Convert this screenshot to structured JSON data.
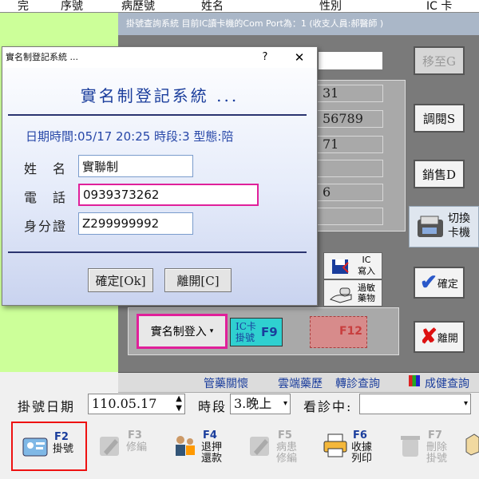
{
  "table_header": {
    "col1": "完",
    "col2": "序號",
    "col3": "病歷號",
    "col4": "姓名",
    "col5": "性別",
    "col6": "IC 卡"
  },
  "back_window": {
    "title": "掛號查詢系統 目前IC讀卡機的Com Port為：1 (收支人員:郝醫師 )",
    "field_values": [
      "31",
      "56789",
      "71",
      "",
      "6",
      ""
    ],
    "buttons": {
      "btn_top": "移至G",
      "btn_browse": "調閱S",
      "btn_cancel": "銷售D",
      "btn_switch": "切換\n卡機",
      "btn_confirm": "確定",
      "btn_leave": "離開"
    },
    "ic_write": {
      "title": "IC",
      "sub": "寫入"
    },
    "allergy": "過敏\n藥物",
    "realname_login": "實名制登入",
    "ic_register": {
      "line1": "IC卡",
      "line2": "掛號",
      "key": "F9"
    },
    "f12_label": "F12",
    "tabs": [
      "管藥關懷",
      "雲端藥歷",
      "轉診查詢",
      "成健查詢"
    ]
  },
  "dialog": {
    "titlebar": "實名制登記系統 ...",
    "help": "?",
    "close": "✕",
    "heading": "實名制登記系統 ...",
    "info": "日期時間:05/17 20:25 時段:3 型態:陪",
    "name_label": "姓　名",
    "name_value": "實聯制",
    "phone_label": "電　話",
    "phone_value": "0939373262",
    "id_label": "身分證",
    "id_value": "Z299999992",
    "ok_button": "確定[Ok]",
    "leave_button": "離開[C]"
  },
  "status_row": {
    "date_label": "掛號日期",
    "date_value": "110.05.17",
    "period_label": "時段",
    "period_value": "3.晚上",
    "visiting_label": "看診中:",
    "visiting_value": ""
  },
  "toolbar": [
    {
      "key": "F2",
      "label": "掛號",
      "enabled": true
    },
    {
      "key": "F3",
      "label": "修編",
      "enabled": false
    },
    {
      "key": "F4",
      "label": "退押\n還款",
      "enabled": true
    },
    {
      "key": "F5",
      "label": "病患\n修編",
      "enabled": false
    },
    {
      "key": "F6",
      "label": "收據\n列印",
      "enabled": true
    },
    {
      "key": "F7",
      "label": "刪除\n掛號",
      "enabled": false
    }
  ],
  "colors": {
    "accent_blue": "#1a3d9c",
    "highlight_magenta": "#e0209a",
    "highlight_red": "#e11",
    "green_bg": "#ccff99"
  }
}
